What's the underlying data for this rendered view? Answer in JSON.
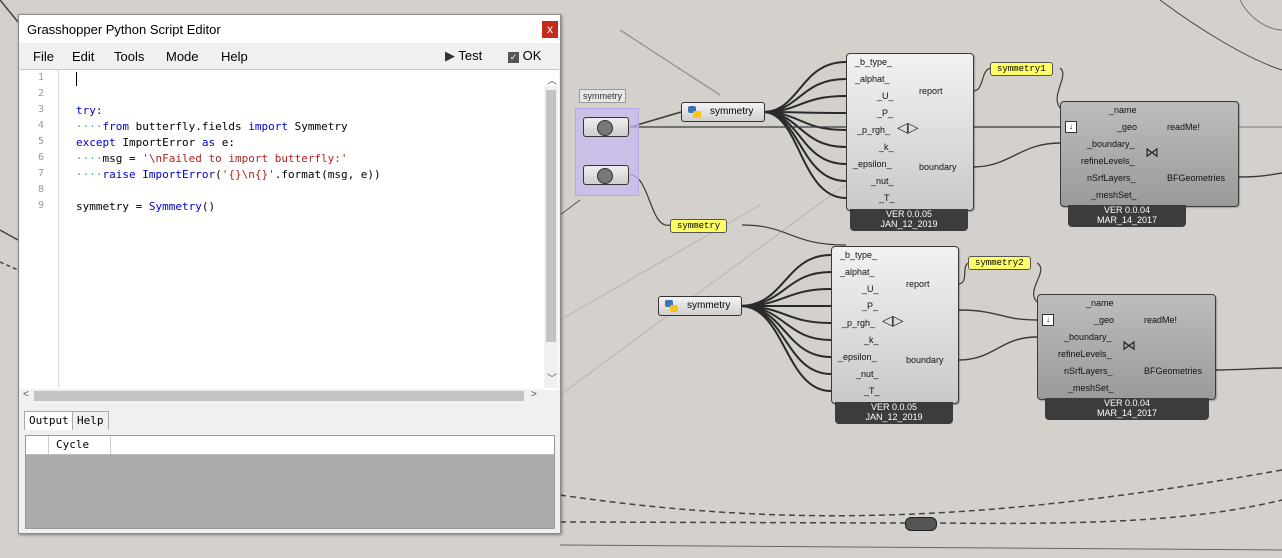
{
  "editor": {
    "title": "Grasshopper Python Script Editor",
    "close_label": "x",
    "menu": [
      "File",
      "Edit",
      "Tools",
      "Mode",
      "Help"
    ],
    "test_label": "Test",
    "ok_label": "OK",
    "line_numbers": [
      "1",
      "2",
      "3",
      "4",
      "5",
      "6",
      "7",
      "8",
      "9"
    ],
    "code_lines": [
      [],
      [],
      [
        {
          "t": "try:",
          "c": "kw"
        }
      ],
      [
        {
          "t": "····",
          "c": "dots"
        },
        {
          "t": "from",
          "c": "kw"
        },
        {
          "t": " butterfly.fields "
        },
        {
          "t": "import",
          "c": "kw"
        },
        {
          "t": " Symmetry"
        }
      ],
      [
        {
          "t": "except",
          "c": "kw"
        },
        {
          "t": " ImportError "
        },
        {
          "t": "as",
          "c": "kw"
        },
        {
          "t": " e:"
        }
      ],
      [
        {
          "t": "····",
          "c": "dots"
        },
        {
          "t": "msg = "
        },
        {
          "t": "'\\nFailed to import butterfly:'",
          "c": "str"
        }
      ],
      [
        {
          "t": "····",
          "c": "dots"
        },
        {
          "t": "raise",
          "c": "kw"
        },
        {
          "t": " "
        },
        {
          "t": "ImportError",
          "c": "kw"
        },
        {
          "t": "("
        },
        {
          "t": "'{}\\n{}'",
          "c": "str"
        },
        {
          "t": ".format(msg, e))"
        }
      ],
      [],
      [
        {
          "t": "symmetry = "
        },
        {
          "t": "Symmetry",
          "c": "kw"
        },
        {
          "t": "()"
        }
      ]
    ],
    "tabs": [
      "Output",
      "Help"
    ],
    "output_column": "Cycle"
  },
  "canvas": {
    "group_label": "symmetry",
    "python_components": [
      {
        "label": "symmetry"
      },
      {
        "label": "symmetry"
      }
    ],
    "panels": [
      "symmetry1",
      "symmetry",
      "symmetry2"
    ],
    "boundary_components": [
      {
        "inputs": [
          "_b_type_",
          "_alphat_",
          "_U_",
          "_P_",
          "_p_rgh_",
          "_k_",
          "_epsilon_",
          "_nut_",
          "_T_"
        ],
        "outputs": [
          "report",
          "boundary"
        ],
        "version": "VER 0.0.05",
        "date": "JAN_12_2019"
      },
      {
        "inputs": [
          "_b_type_",
          "_alphat_",
          "_U_",
          "_P_",
          "_p_rgh_",
          "_k_",
          "_epsilon_",
          "_nut_",
          "_T_"
        ],
        "outputs": [
          "report",
          "boundary"
        ],
        "version": "VER 0.0.05",
        "date": "JAN_12_2019"
      }
    ],
    "geometry_components": [
      {
        "inputs": [
          "_name",
          "_geo",
          "_boundary_",
          "refineLevels_",
          "nSrfLayers_",
          "_meshSet_"
        ],
        "outputs": [
          "readMe!",
          "BFGeometries"
        ],
        "version": "VER 0.0.04",
        "date": "MAR_14_2017"
      },
      {
        "inputs": [
          "_name",
          "_geo",
          "_boundary_",
          "refineLevels_",
          "nSrfLayers_",
          "_meshSet_"
        ],
        "outputs": [
          "readMe!",
          "BFGeometries"
        ],
        "version": "VER 0.0.04",
        "date": "MAR_14_2017"
      }
    ],
    "colors": {
      "canvas": "#d4d1cc",
      "panel": "#ffff66",
      "group": "#c8b8f0",
      "close": "#c42b1c"
    }
  }
}
